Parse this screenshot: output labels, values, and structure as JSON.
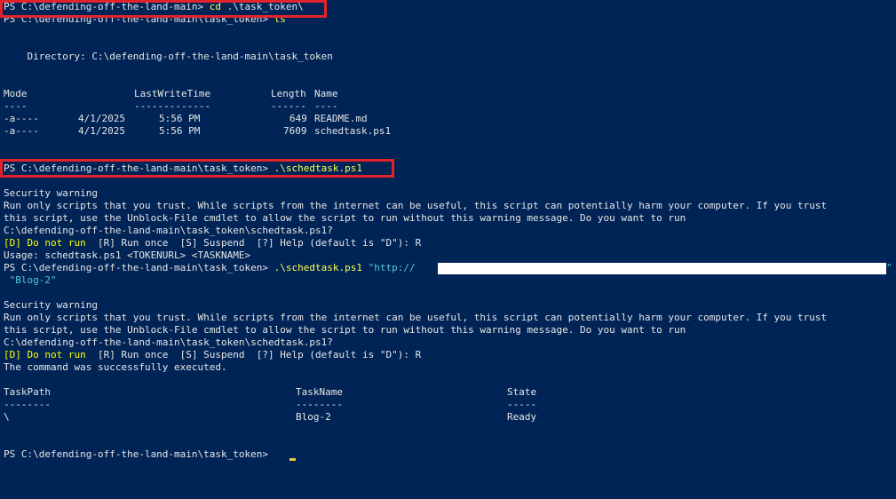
{
  "prompt": "PS C:\\defending-off-the-land-main> ",
  "prompt_task": "PS C:\\defending-off-the-land-main\\task_token> ",
  "cmd_cd": "cd",
  "cmd_cd_arg": " .\\task_token\\",
  "cmd_ls": "ls",
  "directory_line": "    Directory: C:\\defending-off-the-land-main\\task_token",
  "listing": {
    "headers": [
      "Mode",
      "LastWriteTime",
      "Length",
      "Name"
    ],
    "underlines": [
      "----",
      "-------------",
      "------",
      "----"
    ],
    "rows": [
      {
        "mode": "-a----",
        "date": "4/1/2025",
        "time": "5:56 PM",
        "length": "649",
        "name": "README.md"
      },
      {
        "mode": "-a----",
        "date": "4/1/2025",
        "time": "5:56 PM",
        "length": "7609",
        "name": "schedtask.ps1"
      }
    ]
  },
  "cmd_run": ".\\schedtask.ps1",
  "warning": {
    "title": "Security warning",
    "line1": "Run only scripts that you trust. While scripts from the internet can be useful, this script can potentially harm your computer. If you trust",
    "line2": "this script, use the Unblock-File cmdlet to allow the script to run without this warning message. Do you want to run",
    "line3": "C:\\defending-off-the-land-main\\task_token\\schedtask.ps1?",
    "choice_default": "[D] Do not run",
    "choice_rest": "  [R] Run once  [S] Suspend  [?] Help (default is \"D\"): R"
  },
  "usage": "Usage: schedtask.ps1 <TOKENURL> <TASKNAME>",
  "arg_url_start": "\"http://",
  "arg_url_end": "\"",
  "arg_task": " \"Blog-2\"",
  "success": "The command was successfully executed.",
  "task_table": {
    "headers": [
      "TaskPath",
      "TaskName",
      "State"
    ],
    "underlines": [
      "--------",
      "--------",
      "-----"
    ],
    "row": {
      "path": "\\",
      "name": "Blog-2",
      "state": "Ready"
    }
  },
  "colors": {
    "background": "#012456",
    "text": "#e6e6e6",
    "command": "#ffff4d",
    "string": "#55c8d6",
    "highlight": "#e3232b"
  }
}
